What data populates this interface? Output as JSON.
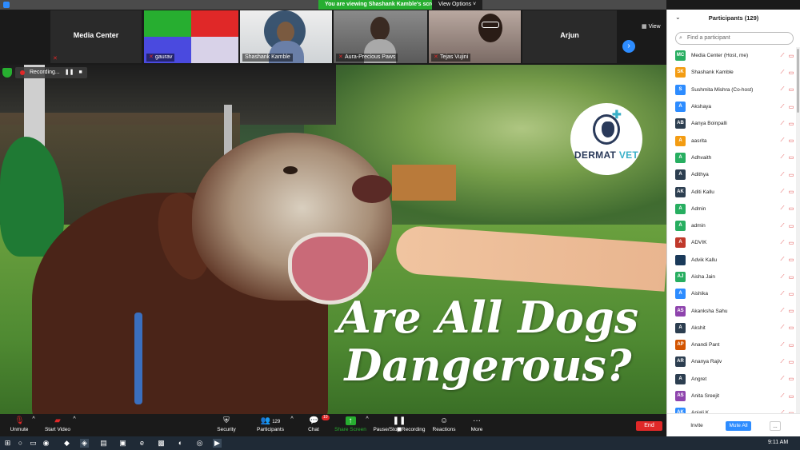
{
  "banner": {
    "sharing_text": "You are viewing Shashank Kamble's screen",
    "view_options": "View Options ˅"
  },
  "thumbnails": [
    {
      "name": "Media Center",
      "style": "name-only"
    },
    {
      "name": "gaurav",
      "style": "color-bars"
    },
    {
      "name": "Shashank Kamble",
      "style": "video"
    },
    {
      "name": "Aura-Precious Paws",
      "style": "video"
    },
    {
      "name": "Tejas Vujini",
      "style": "video"
    },
    {
      "name": "Arjun",
      "style": "name-only"
    }
  ],
  "view_label": "View",
  "recording": {
    "label": "Recording..."
  },
  "shared_content": {
    "logo_text_left": "DERMAT",
    "logo_text_right": "VET",
    "headline_line1": "Are All Dogs",
    "headline_line2": "Dangerous?"
  },
  "toolbar": {
    "unmute": "Unmute",
    "start_video": "Start Video",
    "security": "Security",
    "participants": "Participants",
    "participants_count": "129",
    "chat": "Chat",
    "chat_badge": "10",
    "share_screen": "Share Screen",
    "pause_recording": "Pause/Stop Recording",
    "reactions": "Reactions",
    "more": "More",
    "end": "End"
  },
  "panel": {
    "title": "Participants (129)",
    "search_placeholder": "Find a participant",
    "participants": [
      {
        "initials": "MC",
        "name": "Media Center (Host, me)",
        "color": "#27ae60"
      },
      {
        "initials": "SK",
        "name": "Shashank Kamble",
        "color": "#f39c12"
      },
      {
        "initials": "S",
        "name": "Sushmita Mishra (Co-host)",
        "color": "#2d8cff"
      },
      {
        "initials": "A",
        "name": "Akshaya",
        "color": "#2d8cff"
      },
      {
        "initials": "AB",
        "name": "Aanya Boinpalli",
        "color": "#2c3e50"
      },
      {
        "initials": "A",
        "name": "aasrita",
        "color": "#f39c12"
      },
      {
        "initials": "A",
        "name": "Adhvaith",
        "color": "#27ae60"
      },
      {
        "initials": "A",
        "name": "Adithya",
        "color": "#2c3e50"
      },
      {
        "initials": "AK",
        "name": "Aditi Kallu",
        "color": "#2c3e50"
      },
      {
        "initials": "A",
        "name": "Admin",
        "color": "#27ae60"
      },
      {
        "initials": "A",
        "name": "admin",
        "color": "#27ae60"
      },
      {
        "initials": "A",
        "name": "ADVIK",
        "color": "#c0392b"
      },
      {
        "initials": "",
        "name": "Advik Kallu",
        "color": "#1a3a5a"
      },
      {
        "initials": "AJ",
        "name": "Aisha Jain",
        "color": "#27ae60"
      },
      {
        "initials": "A",
        "name": "Aishika",
        "color": "#2d8cff"
      },
      {
        "initials": "AS",
        "name": "Akanksha Sahu",
        "color": "#8e44ad"
      },
      {
        "initials": "A",
        "name": "Akshit",
        "color": "#2c3e50"
      },
      {
        "initials": "AP",
        "name": "Anandi Pant",
        "color": "#d35400"
      },
      {
        "initials": "AR",
        "name": "Ananya Rajiv",
        "color": "#2c3e50"
      },
      {
        "initials": "A",
        "name": "Angret",
        "color": "#2c3e50"
      },
      {
        "initials": "AS",
        "name": "Anita Sreejit",
        "color": "#8e44ad"
      },
      {
        "initials": "AK",
        "name": "Anjali K",
        "color": "#2d8cff"
      }
    ],
    "invite": "Invite",
    "mute_all": "Mute All",
    "more": "..."
  },
  "taskbar": {
    "clock": "9:11 AM"
  },
  "colors": {
    "zoom_blue": "#2d8cff",
    "share_green": "#27ae30",
    "end_red": "#e02828"
  }
}
